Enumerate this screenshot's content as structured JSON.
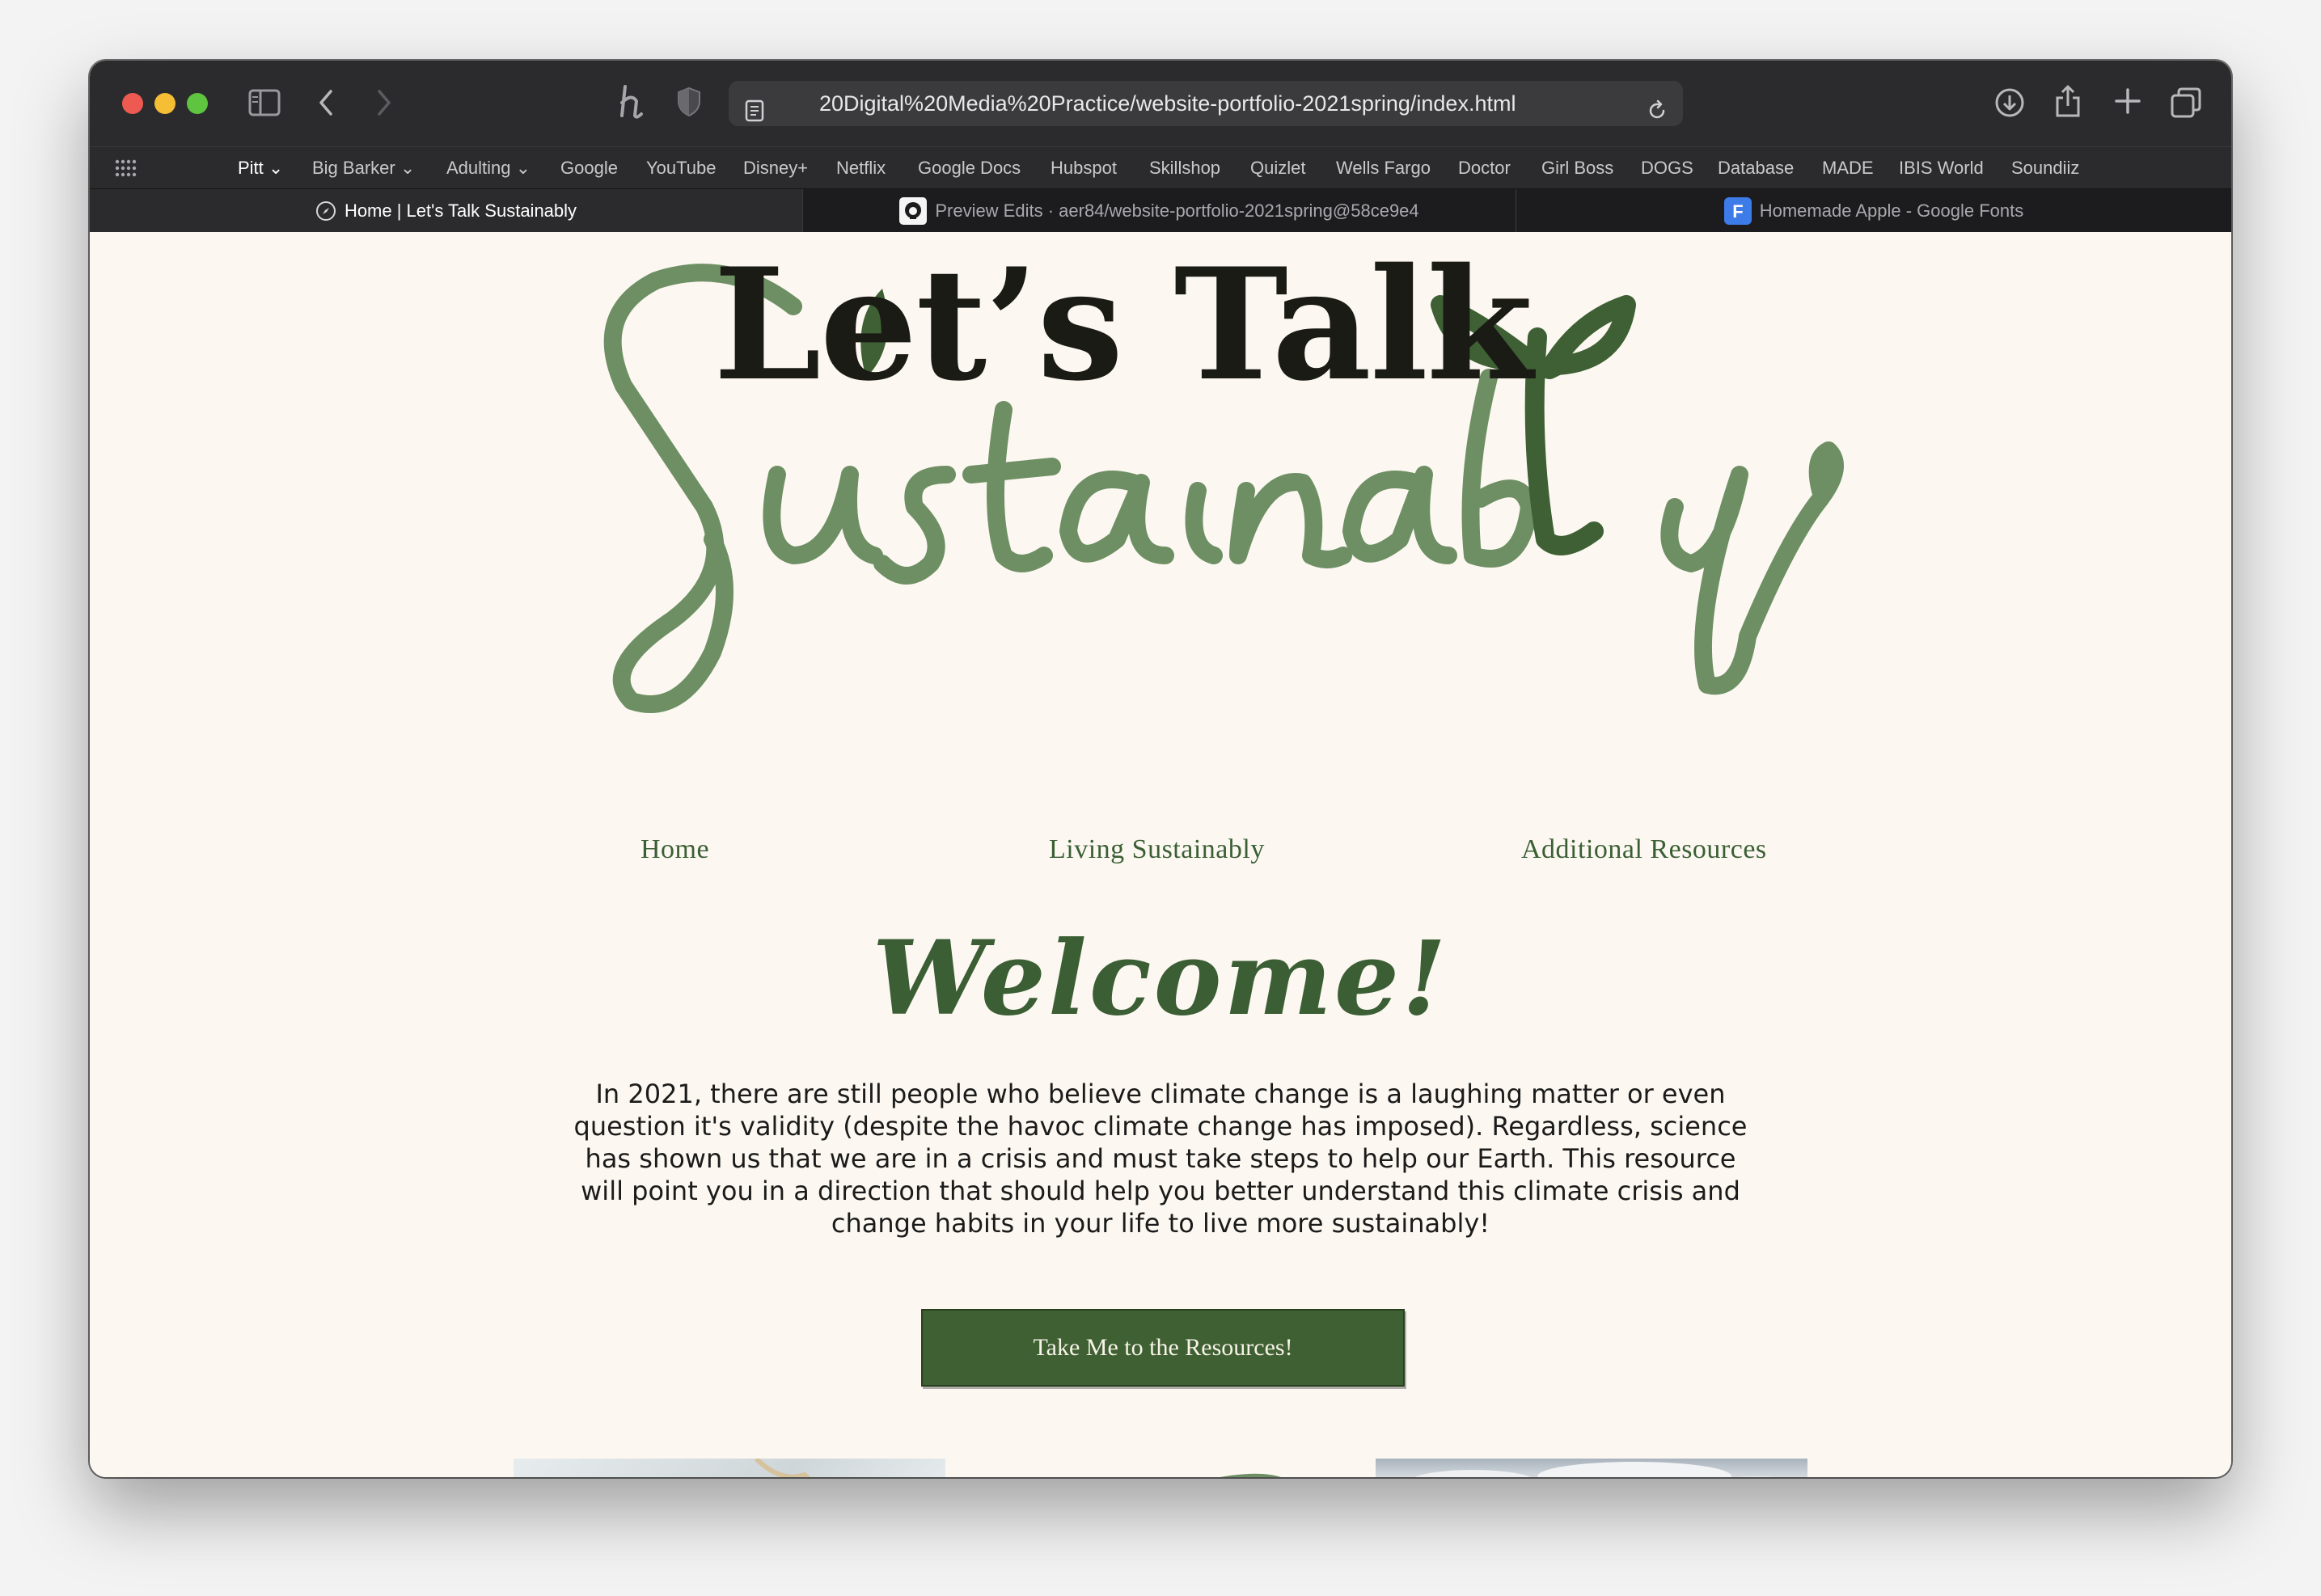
{
  "browser": {
    "url": "20Digital%20Media%20Practice/website-portfolio-2021spring/index.html",
    "bookmarks": [
      {
        "label": "Pitt",
        "dropdown": true
      },
      {
        "label": "Big Barker",
        "dropdown": true
      },
      {
        "label": "Adulting",
        "dropdown": true
      },
      {
        "label": "Google"
      },
      {
        "label": "YouTube"
      },
      {
        "label": "Disney+"
      },
      {
        "label": "Netflix"
      },
      {
        "label": "Google Docs"
      },
      {
        "label": "Hubspot"
      },
      {
        "label": "Skillshop"
      },
      {
        "label": "Quizlet"
      },
      {
        "label": "Wells Fargo"
      },
      {
        "label": "Doctor"
      },
      {
        "label": "Girl Boss"
      },
      {
        "label": "DOGS"
      },
      {
        "label": "Database"
      },
      {
        "label": "MADE"
      },
      {
        "label": "IBIS World"
      },
      {
        "label": "Soundiiz"
      }
    ],
    "tabs": [
      {
        "label": "Home | Let's Talk Sustainably",
        "active": true,
        "icon": "compass-icon"
      },
      {
        "label": "Preview Edits · aer84/website-portfolio-2021spring@58ce9e4",
        "active": false,
        "icon": "github-icon"
      },
      {
        "label": "Homemade Apple - Google Fonts",
        "active": false,
        "icon": "google-fonts-icon"
      }
    ]
  },
  "site": {
    "logo_title": "Let’s Talk",
    "logo_script": "Sustainably",
    "nav": [
      "Home",
      "Living Sustainably",
      "Additional Resources"
    ],
    "welcome": "Welcome!",
    "intro": "In 2021, there are still people who believe climate change is a laughing matter or even question it's validity (despite the havoc climate change has imposed). Regardless, science has shown us that we are in a crisis and must take steps to help our Earth. This resource will point you in a direction that should help you better understand this climate crisis and change habits in your life to live more sustainably!",
    "cta_label": "Take Me to the Resources!"
  },
  "colors": {
    "page_bg": "#fcf8f1",
    "green_dark": "#3f6032",
    "green_light": "#6e8f64",
    "toolbar": "#2b2b2d"
  }
}
